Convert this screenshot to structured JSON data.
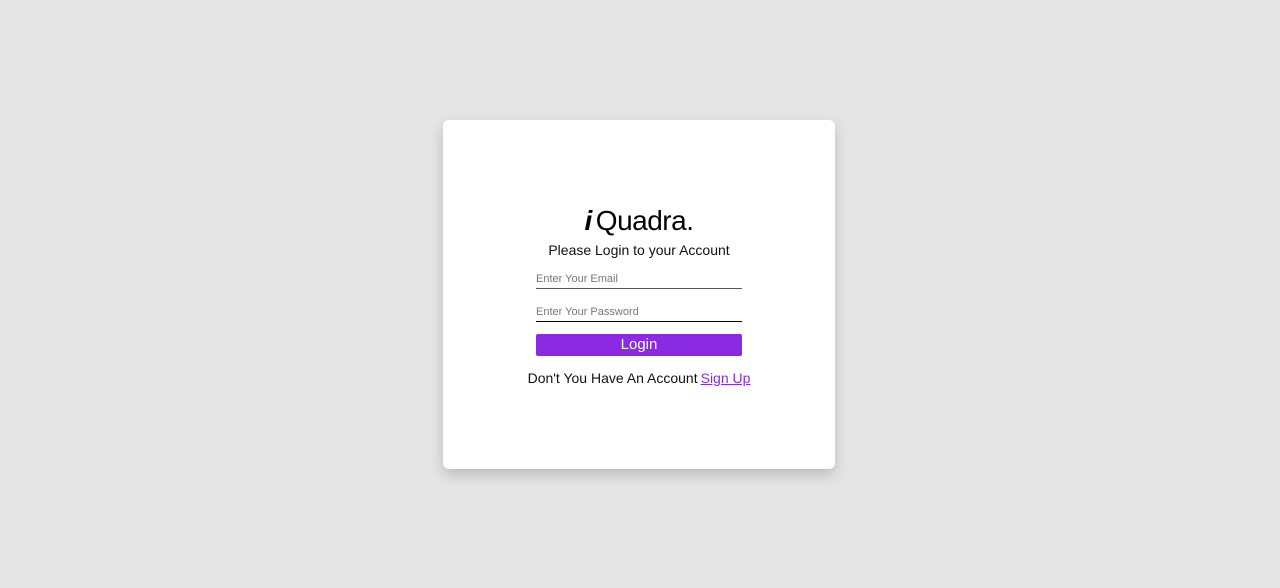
{
  "logo": {
    "mark": "i",
    "name": "Quadra."
  },
  "subtitle": "Please Login to your Account",
  "form": {
    "email_placeholder": "Enter Your Email",
    "password_placeholder": "Enter Your Password",
    "login_label": "Login"
  },
  "signup": {
    "prompt": "Don't You Have An Account",
    "link_label": "Sign Up"
  },
  "colors": {
    "background": "#e5e5e5",
    "card": "#ffffff",
    "accent": "#8a2be2"
  }
}
